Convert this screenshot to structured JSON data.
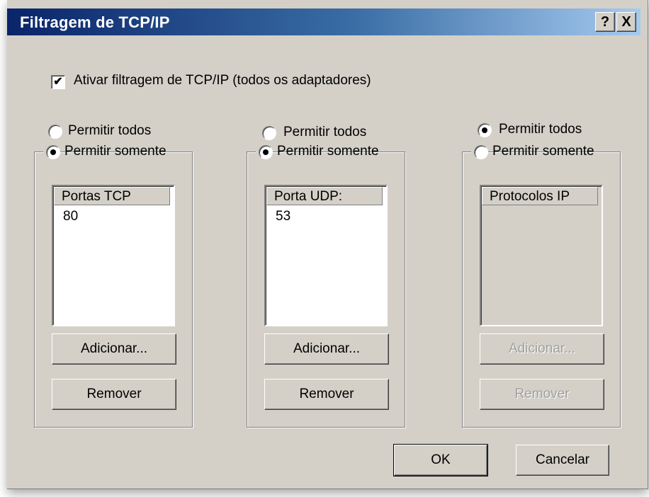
{
  "title": "Filtragem de TCP/IP",
  "titlebar_buttons": {
    "help": "?",
    "close": "X"
  },
  "enable_filter": {
    "label": "Ativar filtragem de TCP/IP (todos os adaptadores)",
    "checked": true
  },
  "groups": [
    {
      "permit_all_label": "Permitir todos",
      "permit_only_label": "Permitir somente",
      "selected": "permit_only",
      "list_header": "Portas TCP",
      "items": [
        "80"
      ],
      "add_label": "Adicionar...",
      "remove_label": "Remover",
      "enabled": true
    },
    {
      "permit_all_label": "Permitir todos",
      "permit_only_label": "Permitir somente",
      "selected": "permit_only",
      "list_header": "Porta UDP:",
      "items": [
        "53"
      ],
      "add_label": "Adicionar...",
      "remove_label": "Remover",
      "enabled": true
    },
    {
      "permit_all_label": "Permitir todos",
      "permit_only_label": "Permitir somente",
      "selected": "permit_all",
      "list_header": "Protocolos IP",
      "items": [],
      "add_label": "Adicionar...",
      "remove_label": "Remover",
      "enabled": false
    }
  ],
  "ok_label": "OK",
  "cancel_label": "Cancelar",
  "icons": {
    "check": "check-icon"
  }
}
